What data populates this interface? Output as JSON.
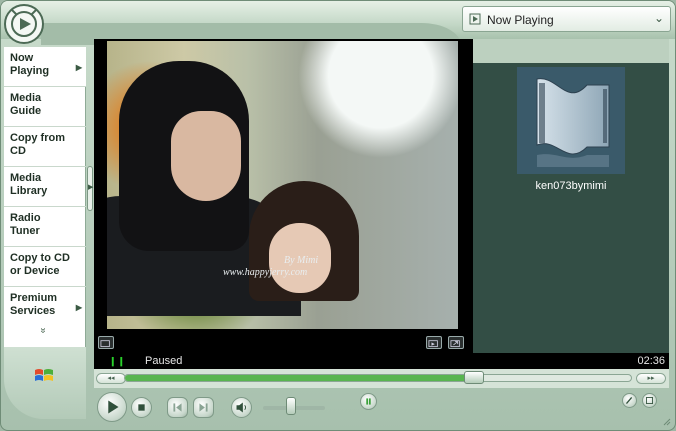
{
  "header": {
    "dropdown_label": "Now Playing",
    "dropdown_icon": "now-playing-icon"
  },
  "sidebar": {
    "items": [
      {
        "label_line1": "Now",
        "label_line2": "Playing"
      },
      {
        "label_line1": "Media",
        "label_line2": "Guide"
      },
      {
        "label_line1": "Copy from",
        "label_line2": "CD"
      },
      {
        "label_line1": "Media",
        "label_line2": "Library"
      },
      {
        "label_line1": "Radio",
        "label_line2": "Tuner"
      },
      {
        "label_line1": "Copy to CD",
        "label_line2": "or Device"
      },
      {
        "label_line1": "Premium",
        "label_line2": "Services"
      }
    ],
    "more_glyph": "»"
  },
  "video": {
    "watermark_line1": "By Mimi",
    "watermark_line2": "www.happyjerry.com"
  },
  "status": {
    "state": "Paused",
    "time": "02:36",
    "indicator": "❙❙"
  },
  "playlist": {
    "item_title": "ken073bymimi"
  },
  "seek": {
    "progress": 0.69,
    "rewind_glyph": "◂◂",
    "ffwd_glyph": "▸▸"
  },
  "volume": {
    "level": 0.45
  },
  "colors": {
    "accent_green": "#58b54f",
    "panel_dark": "#334e45",
    "skin_base": "#b9cfbe"
  }
}
